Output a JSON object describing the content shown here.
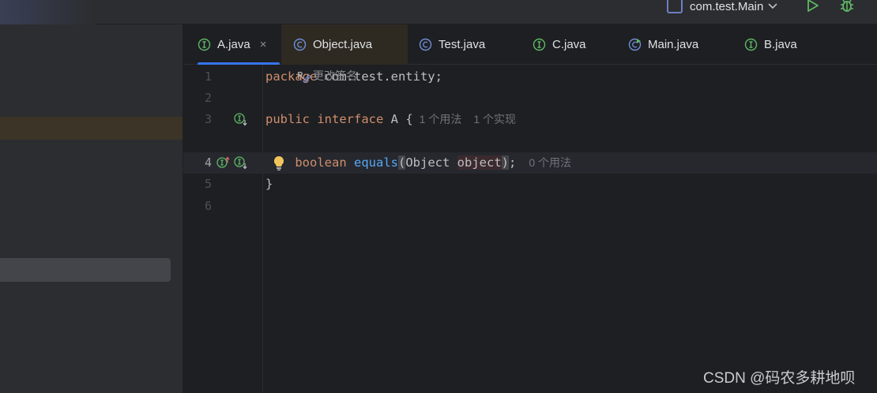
{
  "toolbar": {
    "run_config_label": "com.test.Main",
    "icons": {
      "config": "application-icon",
      "chevron": "chevron-down-icon",
      "run": "run-icon",
      "debug": "debug-icon"
    }
  },
  "tabs": [
    {
      "label": "A.java",
      "icon": "interface-icon",
      "active": true,
      "closable": true
    },
    {
      "label": "Object.java",
      "icon": "class-icon"
    },
    {
      "label": "Test.java",
      "icon": "class-icon"
    },
    {
      "label": "C.java",
      "icon": "interface-icon"
    },
    {
      "label": "Main.java",
      "icon": "runnable-class-icon"
    },
    {
      "label": "B.java",
      "icon": "interface-icon"
    }
  ],
  "tab_close_glyph": "×",
  "editor": {
    "lines": [
      {
        "number": "1",
        "package_kw": "package",
        "rest": " com.test.entity;"
      },
      {
        "number": "2"
      },
      {
        "number": "3",
        "kw1": "public",
        "kw2": "interface",
        "rest": " A {",
        "hint_usages": "1 个用法",
        "hint_impls": "1 个实现"
      },
      {
        "number": "4",
        "indent": "    ",
        "kw": "boolean",
        "fn": "equals",
        "open": "(",
        "type": "Object ",
        "param": "object",
        "close": ")",
        "semi": ";",
        "hint_usages": "0 个用法"
      },
      {
        "number": "5",
        "rest": "}"
      },
      {
        "number": "6"
      }
    ],
    "code_vision_label": "更改签名",
    "colors": {
      "keyword": "#cf8e6d",
      "function": "#56a8f5",
      "text": "#bcbec4",
      "accent": "#3574f0"
    }
  },
  "watermark": "CSDN @码农多耕地呗"
}
